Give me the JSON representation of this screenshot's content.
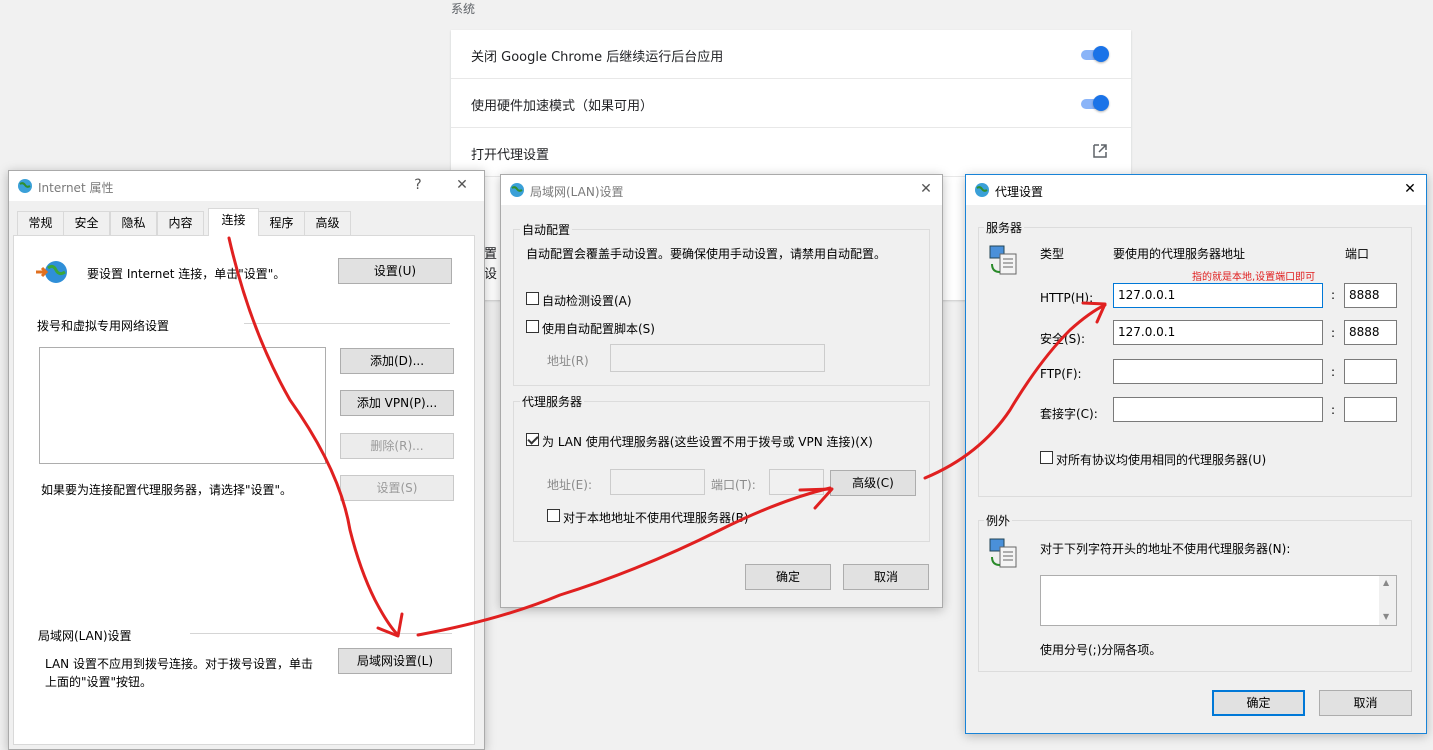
{
  "chrome": {
    "section_title": "系统",
    "rows": [
      {
        "label": "关闭 Google Chrome 后继续运行后台应用",
        "control": "toggle",
        "on": true
      },
      {
        "label": "使用硬件加速模式（如果可用）",
        "control": "toggle",
        "on": true
      },
      {
        "label": "打开代理设置",
        "control": "external-link-icon"
      }
    ],
    "partial_text": [
      "置",
      "设"
    ]
  },
  "internet_props": {
    "title": "Internet 属性",
    "help": "?",
    "close": "✕",
    "tabs": [
      "常规",
      "安全",
      "隐私",
      "内容",
      "连接",
      "程序",
      "高级"
    ],
    "selected_tab": "连接",
    "setup_text": "要设置 Internet 连接，单击\"设置\"。",
    "setup_button": "设置(U)",
    "dialup_label": "拨号和虚拟专用网络设置",
    "add_button": "添加(D)...",
    "add_vpn_button": "添加 VPN(P)...",
    "remove_button": "删除(R)...",
    "proxy_note": "如果要为连接配置代理服务器，请选择\"设置\"。",
    "settings_button": "设置(S)",
    "lan_label": "局域网(LAN)设置",
    "lan_text_1": "LAN 设置不应用到拨号连接。对于拨号设置，单击",
    "lan_text_2": "上面的\"设置\"按钮。",
    "lan_button": "局域网设置(L)"
  },
  "lan_dialog": {
    "title": "局域网(LAN)设置",
    "close": "✕",
    "auto_group": "自动配置",
    "auto_desc": "自动配置会覆盖手动设置。要确保使用手动设置，请禁用自动配置。",
    "auto_detect": "自动检测设置(A)",
    "auto_detect_checked": false,
    "use_script": "使用自动配置脚本(S)",
    "use_script_checked": false,
    "address_label": "地址(R)",
    "proxy_group": "代理服务器",
    "use_proxy": "为 LAN 使用代理服务器(这些设置不用于拨号或 VPN 连接)(X)",
    "use_proxy_checked": true,
    "proxy_address_label": "地址(E):",
    "port_label": "端口(T):",
    "advanced_button": "高级(C)",
    "bypass_local": "对于本地地址不使用代理服务器(B)",
    "bypass_local_checked": false,
    "ok": "确定",
    "cancel": "取消"
  },
  "proxy_dialog": {
    "title": "代理设置",
    "close": "✕",
    "servers_group": "服务器",
    "col_type": "类型",
    "col_address": "要使用的代理服务器地址",
    "col_port": "端口",
    "annotation": "指的就是本地,设置端口即可",
    "rows": [
      {
        "type": "HTTP(H):",
        "address": "127.0.0.1",
        "port": "8888"
      },
      {
        "type": "安全(S):",
        "address": "127.0.0.1",
        "port": "8888"
      },
      {
        "type": "FTP(F):",
        "address": "",
        "port": ""
      },
      {
        "type": "套接字(C):",
        "address": "",
        "port": ""
      }
    ],
    "colon": ":",
    "same_proxy": "对所有协议均使用相同的代理服务器(U)",
    "same_proxy_checked": false,
    "exceptions_group": "例外",
    "exceptions_label": "对于下列字符开头的地址不使用代理服务器(N):",
    "exceptions_value": "",
    "exceptions_hint": "使用分号(;)分隔各项。",
    "ok": "确定",
    "cancel": "取消"
  },
  "colors": {
    "annotation_red": "#e02020",
    "accent_blue": "#0078d7",
    "toggle_blue": "#1a73e8"
  }
}
